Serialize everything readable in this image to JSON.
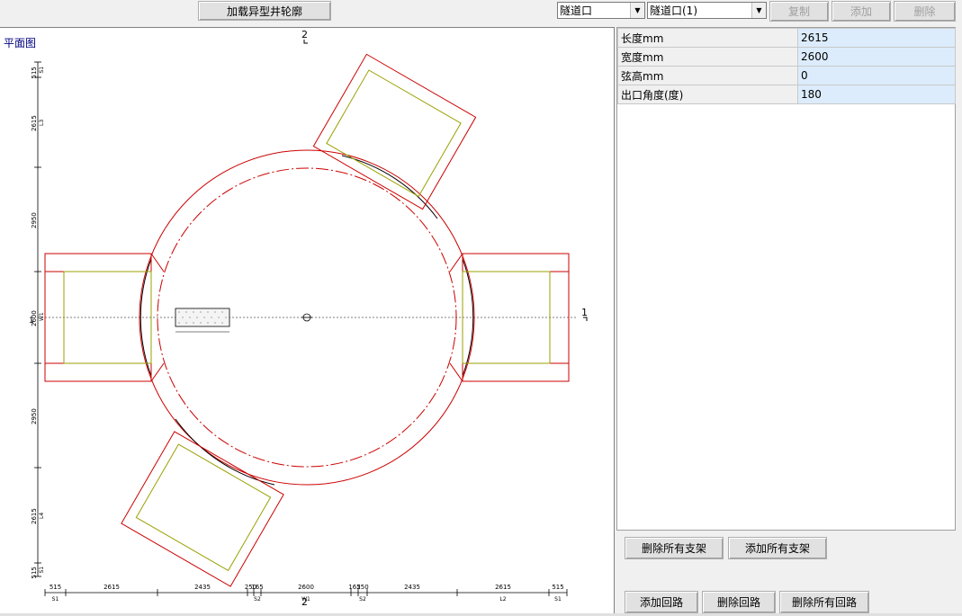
{
  "toolbar": {
    "load_label": "加载异型井轮廓",
    "type_select": "隧道口",
    "item_select": "隧道口(1)",
    "copy_label": "复制",
    "add_label": "添加",
    "delete_label": "删除"
  },
  "plan": {
    "title": "平面图",
    "section_top": "2",
    "section_bottom": "2",
    "section_right": "1",
    "left_dims": [
      {
        "value": "515",
        "code": "S1"
      },
      {
        "value": "2615",
        "code": "L3"
      },
      {
        "value": "2950",
        "code": ""
      },
      {
        "value": "2600",
        "code": "W1"
      },
      {
        "value": "2950",
        "code": ""
      },
      {
        "value": "2615",
        "code": "L4"
      },
      {
        "value": "515",
        "code": "S1"
      }
    ],
    "bottom_dims": [
      {
        "value": "515",
        "code": "S1"
      },
      {
        "value": "2615",
        "code": ""
      },
      {
        "value": "2435",
        "code": ""
      },
      {
        "value": "250",
        "code": ""
      },
      {
        "value": "165",
        "code": "S2"
      },
      {
        "value": "2600",
        "code": "W1"
      },
      {
        "value": "165",
        "code": ""
      },
      {
        "value": "250",
        "code": "S2"
      },
      {
        "value": "2435",
        "code": ""
      },
      {
        "value": "2615",
        "code": "L2"
      },
      {
        "value": "515",
        "code": "S1"
      }
    ]
  },
  "properties": [
    {
      "key": "长度mm",
      "value": "2615"
    },
    {
      "key": "宽度mm",
      "value": "2600"
    },
    {
      "key": "弦高mm",
      "value": "0"
    },
    {
      "key": "出口角度(度)",
      "value": "180"
    }
  ],
  "actions": {
    "delete_all_supports": "删除所有支架",
    "add_all_supports": "添加所有支架",
    "add_loop": "添加回路",
    "delete_loop": "删除回路",
    "delete_all_loops": "删除所有回路"
  },
  "colors": {
    "outline_red": "#cc0000",
    "lining_olive": "#9aa000",
    "wall_black": "#000000",
    "value_bg": "#dcecfc"
  }
}
